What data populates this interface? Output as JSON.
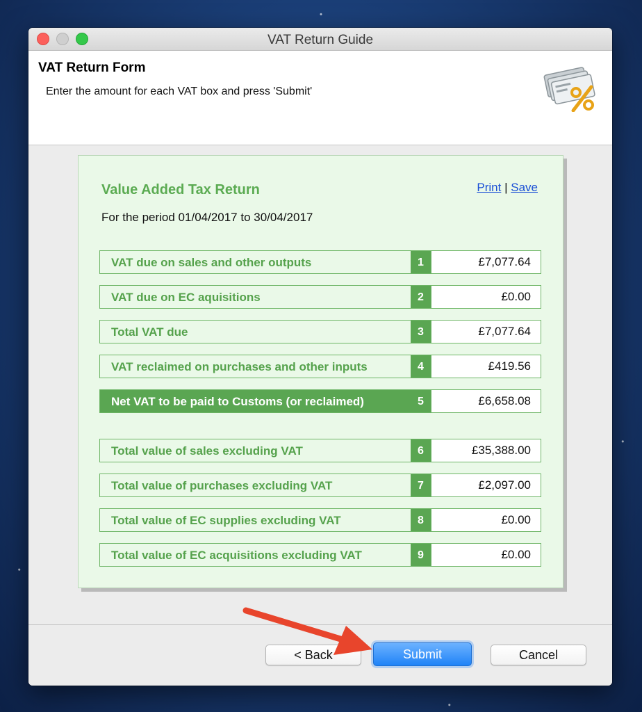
{
  "window": {
    "title": "VAT Return Guide"
  },
  "header": {
    "title": "VAT Return Form",
    "subtitle": "Enter the amount for each VAT box and press 'Submit'",
    "icon": "money-percent-icon"
  },
  "card": {
    "title": "Value Added Tax Return",
    "print_label": "Print",
    "separator": "|",
    "save_label": "Save",
    "period": "For the period 01/04/2017 to 30/04/2017"
  },
  "rows": [
    {
      "label": "VAT due on sales and other outputs",
      "box": "1",
      "value": "£7,077.64"
    },
    {
      "label": "VAT due on EC aquisitions",
      "box": "2",
      "value": "£0.00"
    },
    {
      "label": "Total VAT due",
      "box": "3",
      "value": "£7,077.64"
    },
    {
      "label": "VAT reclaimed on purchases and other inputs",
      "box": "4",
      "value": "£419.56"
    },
    {
      "label": "Net VAT to be paid to Customs (or reclaimed)",
      "box": "5",
      "value": "£6,658.08",
      "highlight": true
    },
    {
      "label": "Total value of sales excluding VAT",
      "box": "6",
      "value": "£35,388.00"
    },
    {
      "label": "Total value of purchases excluding VAT",
      "box": "7",
      "value": "£2,097.00"
    },
    {
      "label": "Total value of EC supplies excluding VAT",
      "box": "8",
      "value": "£0.00"
    },
    {
      "label": "Total value of EC acquisitions excluding VAT",
      "box": "9",
      "value": "£0.00"
    }
  ],
  "buttons": {
    "back": "< Back",
    "submit": "Submit",
    "cancel": "Cancel"
  },
  "colors": {
    "accent_green": "#5aa652",
    "card_bg": "#eaf9e8",
    "submit_blue": "#1f83f7",
    "annotation_arrow": "#e8452c"
  }
}
